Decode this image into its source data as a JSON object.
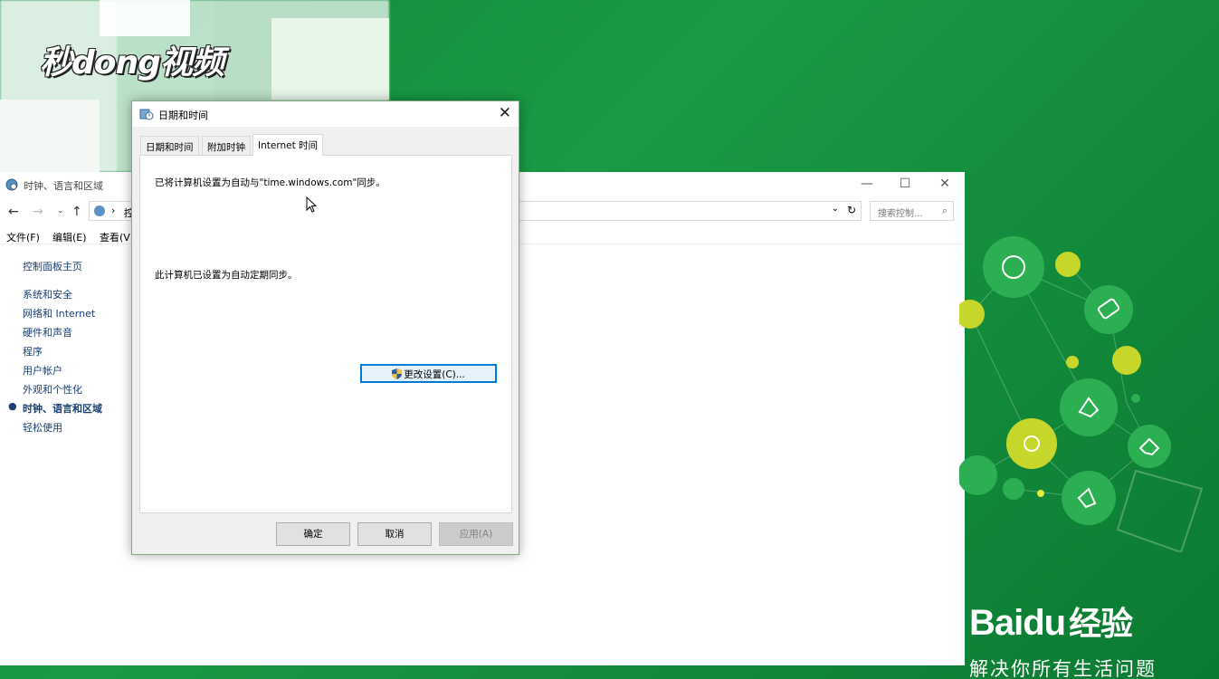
{
  "watermark": {
    "top_logo": "秒dong视频",
    "baidu_logo": "Bai",
    "baidu_du": "du",
    "baidu_jingyan": "经验",
    "baidu_slogan": "解决你所有生活问题"
  },
  "control_panel": {
    "title": "时钟、语言和区域",
    "search_placeholder": "搜索控制...",
    "address_fragment": "控",
    "menu": [
      "文件(F)",
      "编辑(E)",
      "查看(V"
    ],
    "sidebar": {
      "home": "控制面板主页",
      "items": [
        "系统和安全",
        "网络和 Internet",
        "硬件和声音",
        "程序",
        "用户帐户",
        "外观和个性化",
        "时钟、语言和区域",
        "轻松使用"
      ]
    }
  },
  "dialog": {
    "title": "日期和时间",
    "close_symbol": "✕",
    "tabs": [
      "日期和时间",
      "附加时钟",
      "Internet 时间"
    ],
    "active_tab": 2,
    "sync_text": "已将计算机设置为自动与\"time.windows.com\"同步。",
    "schedule_text": "此计算机已设置为自动定期同步。",
    "change_settings_label": "更改设置(C)...",
    "ok_label": "确定",
    "cancel_label": "取消",
    "apply_label": "应用(A)"
  },
  "colors": {
    "accent": "#0078d7",
    "background_green": "#129040",
    "link_blue": "#1a3e72",
    "lime": "#c6d62a"
  }
}
